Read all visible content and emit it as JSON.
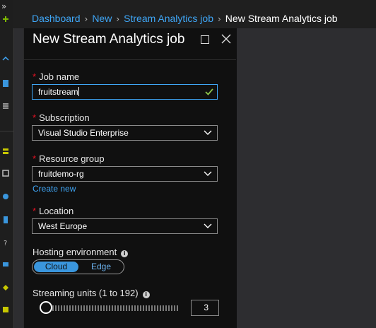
{
  "breadcrumb": {
    "items": [
      "Dashboard",
      "New",
      "Stream Analytics job"
    ],
    "current": "New Stream Analytics job",
    "separator": "›"
  },
  "blade": {
    "title": "New Stream Analytics job",
    "maximize_icon": "maximize-icon",
    "close_icon": "close-icon"
  },
  "form": {
    "required_marker": "*",
    "job_name": {
      "label": "Job name",
      "value": "fruitstream",
      "valid": true
    },
    "subscription": {
      "label": "Subscription",
      "value": "Visual Studio Enterprise"
    },
    "resource_group": {
      "label": "Resource group",
      "value": "fruitdemo-rg",
      "create_new": "Create new"
    },
    "location": {
      "label": "Location",
      "value": "West Europe"
    },
    "hosting": {
      "label": "Hosting environment",
      "options": [
        "Cloud",
        "Edge"
      ],
      "selected": "Cloud"
    },
    "streaming_units": {
      "label": "Streaming units (1 to 192)",
      "value": "3",
      "min": 1,
      "max": 192
    },
    "info_icon": "i"
  },
  "colors": {
    "accent": "#3fa6f6",
    "required": "#e81123",
    "valid_check": "#8bc34a",
    "blade_bg": "#101010"
  }
}
